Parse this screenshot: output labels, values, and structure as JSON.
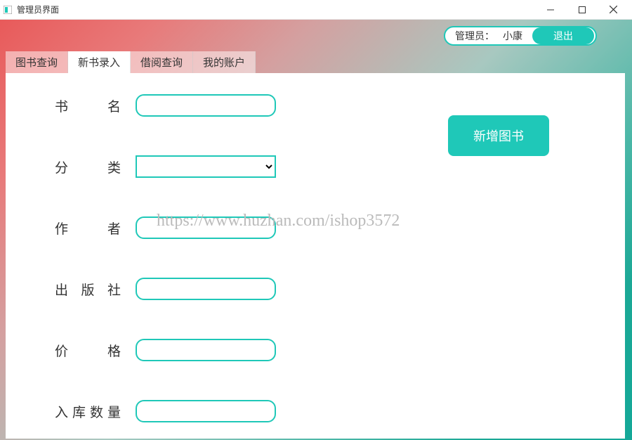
{
  "window": {
    "title": "管理员界面"
  },
  "header": {
    "admin_label": "管理员：",
    "admin_name": "小康",
    "logout_label": "退出"
  },
  "tabs": [
    {
      "label": "图书查询"
    },
    {
      "label": "新书录入"
    },
    {
      "label": "借阅查询"
    },
    {
      "label": "我的账户"
    }
  ],
  "form": {
    "book_name": {
      "label": "书名",
      "value": ""
    },
    "category": {
      "label": "分类",
      "value": ""
    },
    "author": {
      "label": "作者",
      "value": ""
    },
    "publisher": {
      "label": "出版社",
      "value": ""
    },
    "price": {
      "label": "价格",
      "value": ""
    },
    "quantity": {
      "label": "入库数量",
      "value": ""
    }
  },
  "actions": {
    "add_book": "新增图书"
  },
  "watermark": "https://www.huzhan.com/ishop3572"
}
